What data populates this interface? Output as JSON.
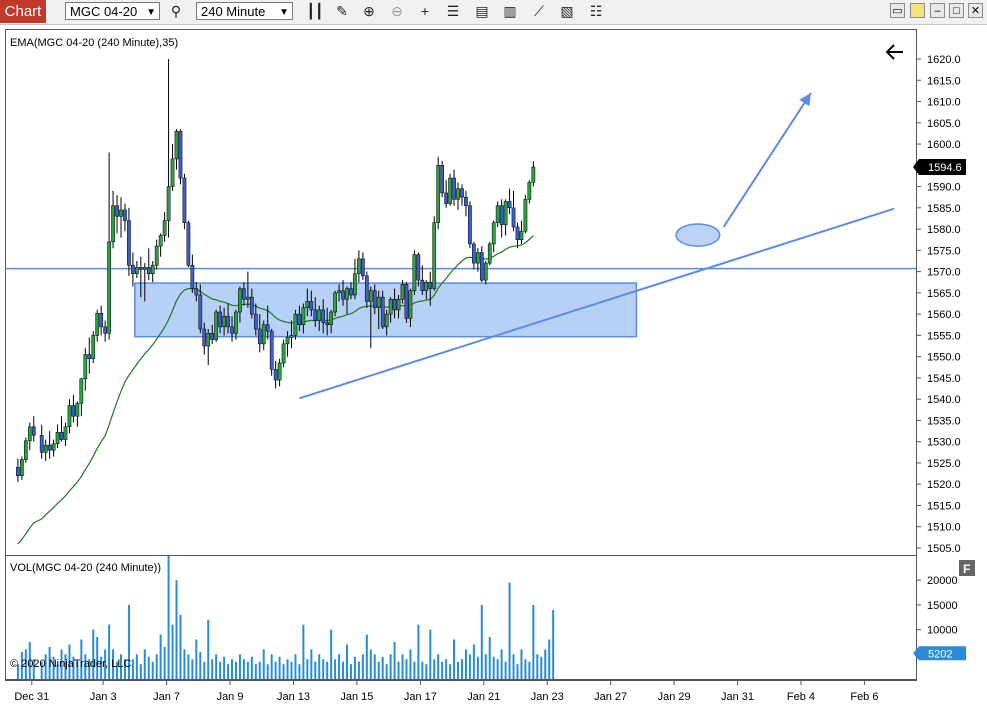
{
  "toolbar": {
    "chart_tab": "Chart",
    "instrument": "MGC 04-20",
    "interval": "240 Minute"
  },
  "price_panel": {
    "indicator_label": "EMA(MGC 04-20 (240 Minute),35)",
    "last_price": "1594.6"
  },
  "volume_panel": {
    "indicator_label": "VOL(MGC 04-20 (240 Minute))",
    "last_volume": "5202",
    "copyright": "© 2020 NinjaTrader, LLC"
  },
  "colors": {
    "up": "#2ea043",
    "down": "#3a5fcd",
    "ema": "#1f7a1f",
    "volume": "#2a8cd6",
    "drawing": "#5a8be8",
    "zone_fill": "#9fc0f2"
  },
  "chart_data": [
    {
      "type": "candlestick",
      "title": "",
      "ylim": [
        1502,
        1625
      ],
      "y_ticks": [
        1505.0,
        1510.0,
        1515.0,
        1520.0,
        1525.0,
        1530.0,
        1535.0,
        1540.0,
        1545.0,
        1550.0,
        1555.0,
        1560.0,
        1565.0,
        1570.0,
        1575.0,
        1580.0,
        1585.0,
        1590.0,
        1595.0,
        1600.0,
        1605.0,
        1610.0,
        1615.0,
        1620.0
      ],
      "x_ticks": [
        "Dec 31",
        "Jan 3",
        "Jan 7",
        "Jan 9",
        "Jan 13",
        "Jan 15",
        "Jan 17",
        "Jan 21",
        "Jan 23",
        "Jan 27",
        "Jan 29",
        "Jan 31",
        "Feb 4",
        "Feb 6"
      ],
      "x_tick_index": [
        5.5,
        23.5,
        39.5,
        55.5,
        71.5,
        87.5,
        103.5,
        119.5,
        135.5,
        151.5,
        167.5,
        183.5,
        199.5,
        215.5
      ],
      "n_slots": 228,
      "horizontal_line": 1570.7,
      "zone": {
        "from_index": 31.5,
        "to_index": 158,
        "low": 1554.7,
        "high": 1567.3
      },
      "trendline": {
        "x0": 73,
        "y0": 1540.2,
        "x1": 223,
        "y1": 1584.8
      },
      "projection_arrow": {
        "x0": 180,
        "y0": 1580.5,
        "x1": 202,
        "y1": 1612
      },
      "ellipse": {
        "cx": 173.5,
        "cy": 1578.6,
        "rx": 5.5,
        "ry": 2.6
      },
      "ema_last": 1578.5,
      "candles": [
        [
          1524.0,
          1526.0,
          1520.5,
          1522.0
        ],
        [
          1522.0,
          1526.5,
          1521.0,
          1525.8
        ],
        [
          1525.8,
          1531.0,
          1525.0,
          1530.2
        ],
        [
          1530.2,
          1534.5,
          1528.0,
          1533.5
        ],
        [
          1533.5,
          1536.0,
          1530.0,
          1531.5
        ],
        [
          1531.5,
          1534.0,
          1526.0,
          1527.5
        ],
        [
          1527.5,
          1530.5,
          1525.5,
          1529.2
        ],
        [
          1529.2,
          1532.5,
          1526.0,
          1528.0
        ],
        [
          1528.0,
          1530.5,
          1526.5,
          1529.5
        ],
        [
          1529.5,
          1534.0,
          1528.5,
          1532.2
        ],
        [
          1532.2,
          1536.0,
          1530.0,
          1530.5
        ],
        [
          1530.5,
          1534.5,
          1529.0,
          1533.5
        ],
        [
          1533.5,
          1540.0,
          1532.0,
          1538.5
        ],
        [
          1538.5,
          1541.0,
          1534.5,
          1536.0
        ],
        [
          1536.0,
          1539.5,
          1533.5,
          1539.0
        ],
        [
          1539.0,
          1545.0,
          1536.0,
          1544.8
        ],
        [
          1544.8,
          1552.0,
          1542.0,
          1550.5
        ],
        [
          1550.5,
          1554.5,
          1546.0,
          1549.5
        ],
        [
          1549.5,
          1556.0,
          1548.5,
          1555.0
        ],
        [
          1555.0,
          1561.0,
          1553.5,
          1560.2
        ],
        [
          1560.2,
          1562.0,
          1555.0,
          1557.0
        ],
        [
          1557.0,
          1558.5,
          1553.5,
          1555.5
        ],
        [
          1555.5,
          1598.0,
          1554.0,
          1577.0
        ],
        [
          1577.0,
          1589.0,
          1575.5,
          1585.5
        ],
        [
          1585.5,
          1588.0,
          1579.0,
          1583.0
        ],
        [
          1583.0,
          1587.5,
          1578.0,
          1584.5
        ],
        [
          1584.5,
          1586.0,
          1579.5,
          1582.0
        ],
        [
          1582.0,
          1585.0,
          1569.0,
          1571.5
        ],
        [
          1571.5,
          1574.5,
          1566.5,
          1569.5
        ],
        [
          1569.5,
          1572.5,
          1568.5,
          1571.0
        ],
        [
          1571.0,
          1573.5,
          1564.0,
          1570.5
        ],
        [
          1570.5,
          1572.0,
          1563.0,
          1571.0
        ],
        [
          1571.0,
          1575.5,
          1568.0,
          1569.5
        ],
        [
          1569.5,
          1572.5,
          1567.5,
          1571.5
        ],
        [
          1571.5,
          1577.5,
          1570.5,
          1576.0
        ],
        [
          1576.0,
          1579.0,
          1573.5,
          1578.5
        ],
        [
          1578.5,
          1584.0,
          1577.0,
          1582.0
        ],
        [
          1582.0,
          1620.0,
          1578.0,
          1590.0
        ],
        [
          1590.0,
          1600.0,
          1589.0,
          1596.5
        ],
        [
          1596.5,
          1603.5,
          1594.0,
          1603.0
        ],
        [
          1603.0,
          1603.5,
          1590.5,
          1592.0
        ],
        [
          1592.0,
          1593.0,
          1580.0,
          1581.5
        ],
        [
          1581.5,
          1582.0,
          1571.0,
          1571.5
        ],
        [
          1571.5,
          1574.0,
          1565.0,
          1566.0
        ],
        [
          1566.0,
          1567.5,
          1563.0,
          1564.5
        ],
        [
          1564.5,
          1567.0,
          1555.5,
          1556.5
        ],
        [
          1556.5,
          1558.0,
          1550.5,
          1552.5
        ],
        [
          1552.5,
          1556.5,
          1548.0,
          1555.5
        ],
        [
          1555.5,
          1557.5,
          1553.0,
          1554.0
        ],
        [
          1554.0,
          1561.0,
          1553.5,
          1560.5
        ],
        [
          1560.5,
          1562.0,
          1555.5,
          1557.0
        ],
        [
          1557.0,
          1561.5,
          1555.0,
          1559.5
        ],
        [
          1559.5,
          1562.5,
          1555.5,
          1557.0
        ],
        [
          1557.0,
          1559.5,
          1553.5,
          1555.5
        ],
        [
          1555.5,
          1561.0,
          1554.0,
          1560.5
        ],
        [
          1560.5,
          1566.5,
          1558.0,
          1566.0
        ],
        [
          1566.0,
          1567.5,
          1562.0,
          1563.5
        ],
        [
          1563.5,
          1570.0,
          1561.5,
          1564.0
        ],
        [
          1564.0,
          1566.0,
          1559.0,
          1560.0
        ],
        [
          1560.0,
          1562.5,
          1555.0,
          1556.5
        ],
        [
          1556.5,
          1560.0,
          1551.0,
          1553.0
        ],
        [
          1553.0,
          1558.5,
          1551.5,
          1557.5
        ],
        [
          1557.5,
          1562.0,
          1554.0,
          1556.0
        ],
        [
          1556.0,
          1556.5,
          1545.5,
          1547.0
        ],
        [
          1547.0,
          1549.0,
          1542.5,
          1544.5
        ],
        [
          1544.5,
          1549.5,
          1543.0,
          1548.5
        ],
        [
          1548.5,
          1554.0,
          1547.5,
          1553.0
        ],
        [
          1553.0,
          1556.0,
          1550.0,
          1554.5
        ],
        [
          1554.5,
          1558.5,
          1552.0,
          1555.0
        ],
        [
          1555.0,
          1561.0,
          1554.0,
          1560.0
        ],
        [
          1560.0,
          1562.0,
          1556.0,
          1557.5
        ],
        [
          1557.5,
          1562.5,
          1555.5,
          1561.5
        ],
        [
          1561.5,
          1566.0,
          1559.5,
          1563.0
        ],
        [
          1563.0,
          1565.5,
          1559.5,
          1561.0
        ],
        [
          1561.0,
          1564.0,
          1557.0,
          1558.5
        ],
        [
          1558.5,
          1562.0,
          1556.0,
          1561.0
        ],
        [
          1561.0,
          1563.5,
          1555.5,
          1558.0
        ],
        [
          1558.0,
          1561.5,
          1555.0,
          1557.5
        ],
        [
          1557.5,
          1561.0,
          1555.5,
          1560.5
        ],
        [
          1560.5,
          1565.5,
          1559.5,
          1565.0
        ],
        [
          1565.0,
          1567.0,
          1563.0,
          1565.5
        ],
        [
          1565.5,
          1568.0,
          1562.0,
          1563.5
        ],
        [
          1563.5,
          1566.5,
          1560.0,
          1566.0
        ],
        [
          1566.0,
          1567.5,
          1563.5,
          1564.5
        ],
        [
          1564.5,
          1573.0,
          1563.5,
          1569.5
        ],
        [
          1569.5,
          1575.0,
          1567.5,
          1573.0
        ],
        [
          1573.0,
          1574.5,
          1568.0,
          1569.0
        ],
        [
          1569.0,
          1570.0,
          1561.5,
          1563.0
        ],
        [
          1563.0,
          1566.5,
          1552.0,
          1565.5
        ],
        [
          1565.5,
          1567.0,
          1560.0,
          1561.5
        ],
        [
          1561.5,
          1565.5,
          1556.5,
          1564.0
        ],
        [
          1564.0,
          1565.5,
          1556.5,
          1557.0
        ],
        [
          1557.0,
          1561.0,
          1555.0,
          1560.0
        ],
        [
          1560.0,
          1564.0,
          1558.0,
          1563.5
        ],
        [
          1563.5,
          1566.0,
          1559.0,
          1561.0
        ],
        [
          1561.0,
          1564.5,
          1559.0,
          1563.5
        ],
        [
          1563.5,
          1568.0,
          1562.5,
          1567.0
        ],
        [
          1567.0,
          1567.5,
          1558.0,
          1559.0
        ],
        [
          1559.0,
          1566.0,
          1557.0,
          1565.5
        ],
        [
          1565.5,
          1575.0,
          1564.5,
          1574.0
        ],
        [
          1574.0,
          1574.5,
          1566.5,
          1568.0
        ],
        [
          1568.0,
          1571.5,
          1564.5,
          1565.5
        ],
        [
          1565.5,
          1568.0,
          1563.5,
          1567.5
        ],
        [
          1567.5,
          1570.0,
          1562.0,
          1566.0
        ],
        [
          1566.0,
          1583.0,
          1565.5,
          1581.5
        ],
        [
          1581.5,
          1597.0,
          1580.0,
          1595.0
        ],
        [
          1595.0,
          1596.0,
          1587.5,
          1588.5
        ],
        [
          1588.5,
          1591.5,
          1585.0,
          1586.0
        ],
        [
          1586.0,
          1593.0,
          1585.5,
          1592.0
        ],
        [
          1592.0,
          1594.0,
          1585.5,
          1587.0
        ],
        [
          1587.0,
          1591.0,
          1584.5,
          1589.5
        ],
        [
          1589.5,
          1590.5,
          1585.5,
          1587.5
        ],
        [
          1587.5,
          1589.0,
          1583.0,
          1585.5
        ],
        [
          1585.5,
          1586.5,
          1575.5,
          1576.5
        ],
        [
          1576.5,
          1577.0,
          1570.5,
          1572.0
        ],
        [
          1572.0,
          1575.5,
          1570.0,
          1574.5
        ],
        [
          1574.5,
          1576.0,
          1567.5,
          1568.0
        ],
        [
          1568.0,
          1572.5,
          1567.0,
          1572.0
        ],
        [
          1572.0,
          1577.0,
          1571.5,
          1576.5
        ],
        [
          1576.5,
          1582.0,
          1574.5,
          1581.5
        ],
        [
          1581.5,
          1586.5,
          1580.5,
          1585.5
        ],
        [
          1585.5,
          1587.0,
          1578.0,
          1581.0
        ],
        [
          1581.0,
          1587.0,
          1578.5,
          1586.5
        ],
        [
          1586.5,
          1589.5,
          1583.5,
          1585.0
        ],
        [
          1585.0,
          1589.0,
          1579.5,
          1580.5
        ],
        [
          1580.5,
          1581.5,
          1575.5,
          1577.5
        ],
        [
          1577.5,
          1582.0,
          1576.5,
          1579.5
        ],
        [
          1579.5,
          1588.0,
          1579.0,
          1587.0
        ],
        [
          1587.0,
          1591.5,
          1586.0,
          1591.0
        ],
        [
          1591.0,
          1596.0,
          1590.0,
          1594.6
        ]
      ],
      "candle_index": [
        2,
        3,
        4,
        5,
        6,
        8,
        9,
        10,
        11,
        12,
        13,
        14,
        15,
        16,
        17,
        18,
        19,
        20,
        21,
        22,
        23,
        24,
        25,
        26,
        27,
        28,
        29,
        30,
        31,
        32,
        33,
        34,
        35,
        36,
        37,
        38,
        39,
        40,
        41,
        42,
        43,
        44,
        45,
        46,
        47,
        48,
        49,
        50,
        51,
        52,
        53,
        54,
        55,
        56,
        57,
        58,
        59,
        60,
        61,
        62,
        63,
        64,
        65,
        66,
        67,
        68,
        69,
        70,
        71,
        72,
        73,
        74,
        75,
        76,
        77,
        78,
        79,
        80,
        81,
        82,
        83,
        84,
        85,
        86,
        87,
        88,
        89,
        90,
        91,
        92,
        93,
        94,
        95,
        96,
        97,
        98,
        99,
        100,
        101,
        102,
        103,
        104,
        105,
        106,
        107,
        108,
        109,
        110,
        111,
        112,
        113,
        114,
        115,
        116,
        117,
        118,
        119,
        120,
        121,
        122,
        123,
        124,
        125,
        126,
        127,
        128,
        129,
        130,
        131,
        132,
        133,
        134,
        135,
        136,
        137,
        138,
        139,
        140,
        141,
        142,
        143,
        144,
        145,
        146,
        147,
        148,
        149,
        150,
        151,
        152
      ]
    },
    {
      "type": "bar",
      "title": "",
      "ylim": [
        0,
        24500
      ],
      "y_ticks": [
        10000,
        15000,
        20000
      ],
      "volumes": [
        3000,
        5500,
        6000,
        7500,
        4000,
        3500,
        5000,
        6500,
        4500,
        3000,
        6000,
        5000,
        7000,
        4500,
        3500,
        8000,
        5000,
        4000,
        10000,
        8500,
        4500,
        6000,
        11000,
        6000,
        3500,
        5000,
        4000,
        15000,
        4000,
        5000,
        3000,
        6000,
        4500,
        3500,
        5000,
        9000,
        6500,
        25000,
        11000,
        20000,
        13000,
        6000,
        5000,
        4000,
        8000,
        5500,
        3500,
        12000,
        4000,
        5000,
        3500,
        4500,
        3000,
        4000,
        3500,
        5000,
        4000,
        3500,
        4500,
        3000,
        3500,
        6000,
        3000,
        5000,
        3500,
        4500,
        3000,
        4000,
        3500,
        5000,
        3000,
        11000,
        4000,
        6000,
        3500,
        5000,
        4000,
        3500,
        10000,
        4000,
        5000,
        3500,
        7000,
        3000,
        4500,
        3500,
        5000,
        9000,
        6000,
        5000,
        3500,
        4500,
        3000,
        5000,
        7500,
        3500,
        5000,
        4000,
        6000,
        3500,
        11000,
        3500,
        3000,
        10000,
        4000,
        5000,
        3500,
        4000,
        3000,
        8000,
        3500,
        4000,
        6000,
        5000,
        7000,
        4500,
        15000,
        5000,
        8500,
        4500,
        4000,
        6000,
        3500,
        19500,
        5000,
        3000,
        6000,
        4000,
        3500,
        15000,
        5000,
        4500,
        6000,
        8000,
        14000
      ]
    }
  ]
}
